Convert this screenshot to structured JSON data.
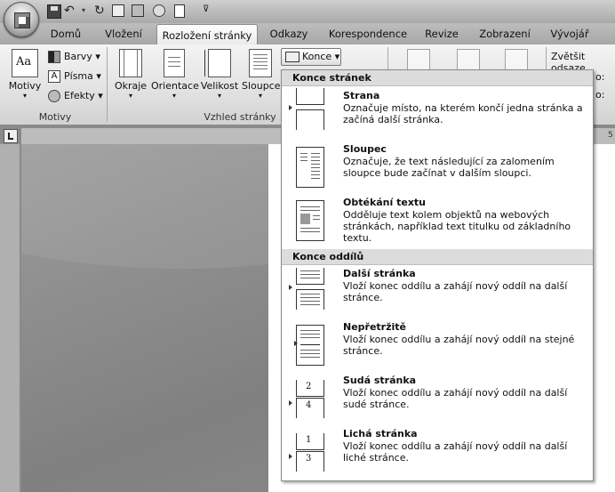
{
  "tabs": [
    "Domů",
    "Vložení",
    "Rozložení stránky",
    "Odkazy",
    "Korespondence",
    "Revize",
    "Zobrazení",
    "Vývojář"
  ],
  "active_tab": "Rozložení stránky",
  "ribbon": {
    "motivy_button": "Motivy",
    "barvy": "Barvy",
    "pisma": "Písma",
    "efekty": "Efekty",
    "motivy_group": "Motivy",
    "okraje": "Okraje",
    "orientace": "Orientace",
    "velikost": "Velikost",
    "sloupce": "Sloupce",
    "konce": "Konce",
    "vzhled_group": "Vzhled stránky",
    "zvetsit": "Zvětšit odsaze",
    "right_o1": "o:",
    "right_o2": "o:"
  },
  "ruler": {
    "num": "5"
  },
  "dropdown": {
    "section1": "Konce stránek",
    "section2": "Konce oddílů",
    "items": [
      {
        "title": "Strana",
        "desc": "Označuje místo, na kterém končí jedna stránka a začíná další stránka."
      },
      {
        "title": "Sloupec",
        "desc": "Označuje, že text následující za zalomením sloupce bude začínat v dalším sloupci."
      },
      {
        "title": "Obtékání textu",
        "desc": "Odděluje text kolem objektů na webových stránkách, například text titulku od základního textu."
      },
      {
        "title": "Další stránka",
        "desc": "Vloží konec oddílu a zahájí nový oddíl na další stránce."
      },
      {
        "title": "Nepřetržitě",
        "desc": "Vloží konec oddílu a zahájí nový oddíl na stejné stránce."
      },
      {
        "title": "Sudá stránka",
        "desc": "Vloží konec oddílu a zahájí nový oddíl na další sudé stránce."
      },
      {
        "title": "Lichá stránka",
        "desc": "Vloží konec oddílu a zahájí nový oddíl na další liché stránce."
      }
    ],
    "icon_numbers": {
      "even_top": "2",
      "even_bottom": "4",
      "odd_top": "1",
      "odd_bottom": "3"
    }
  }
}
